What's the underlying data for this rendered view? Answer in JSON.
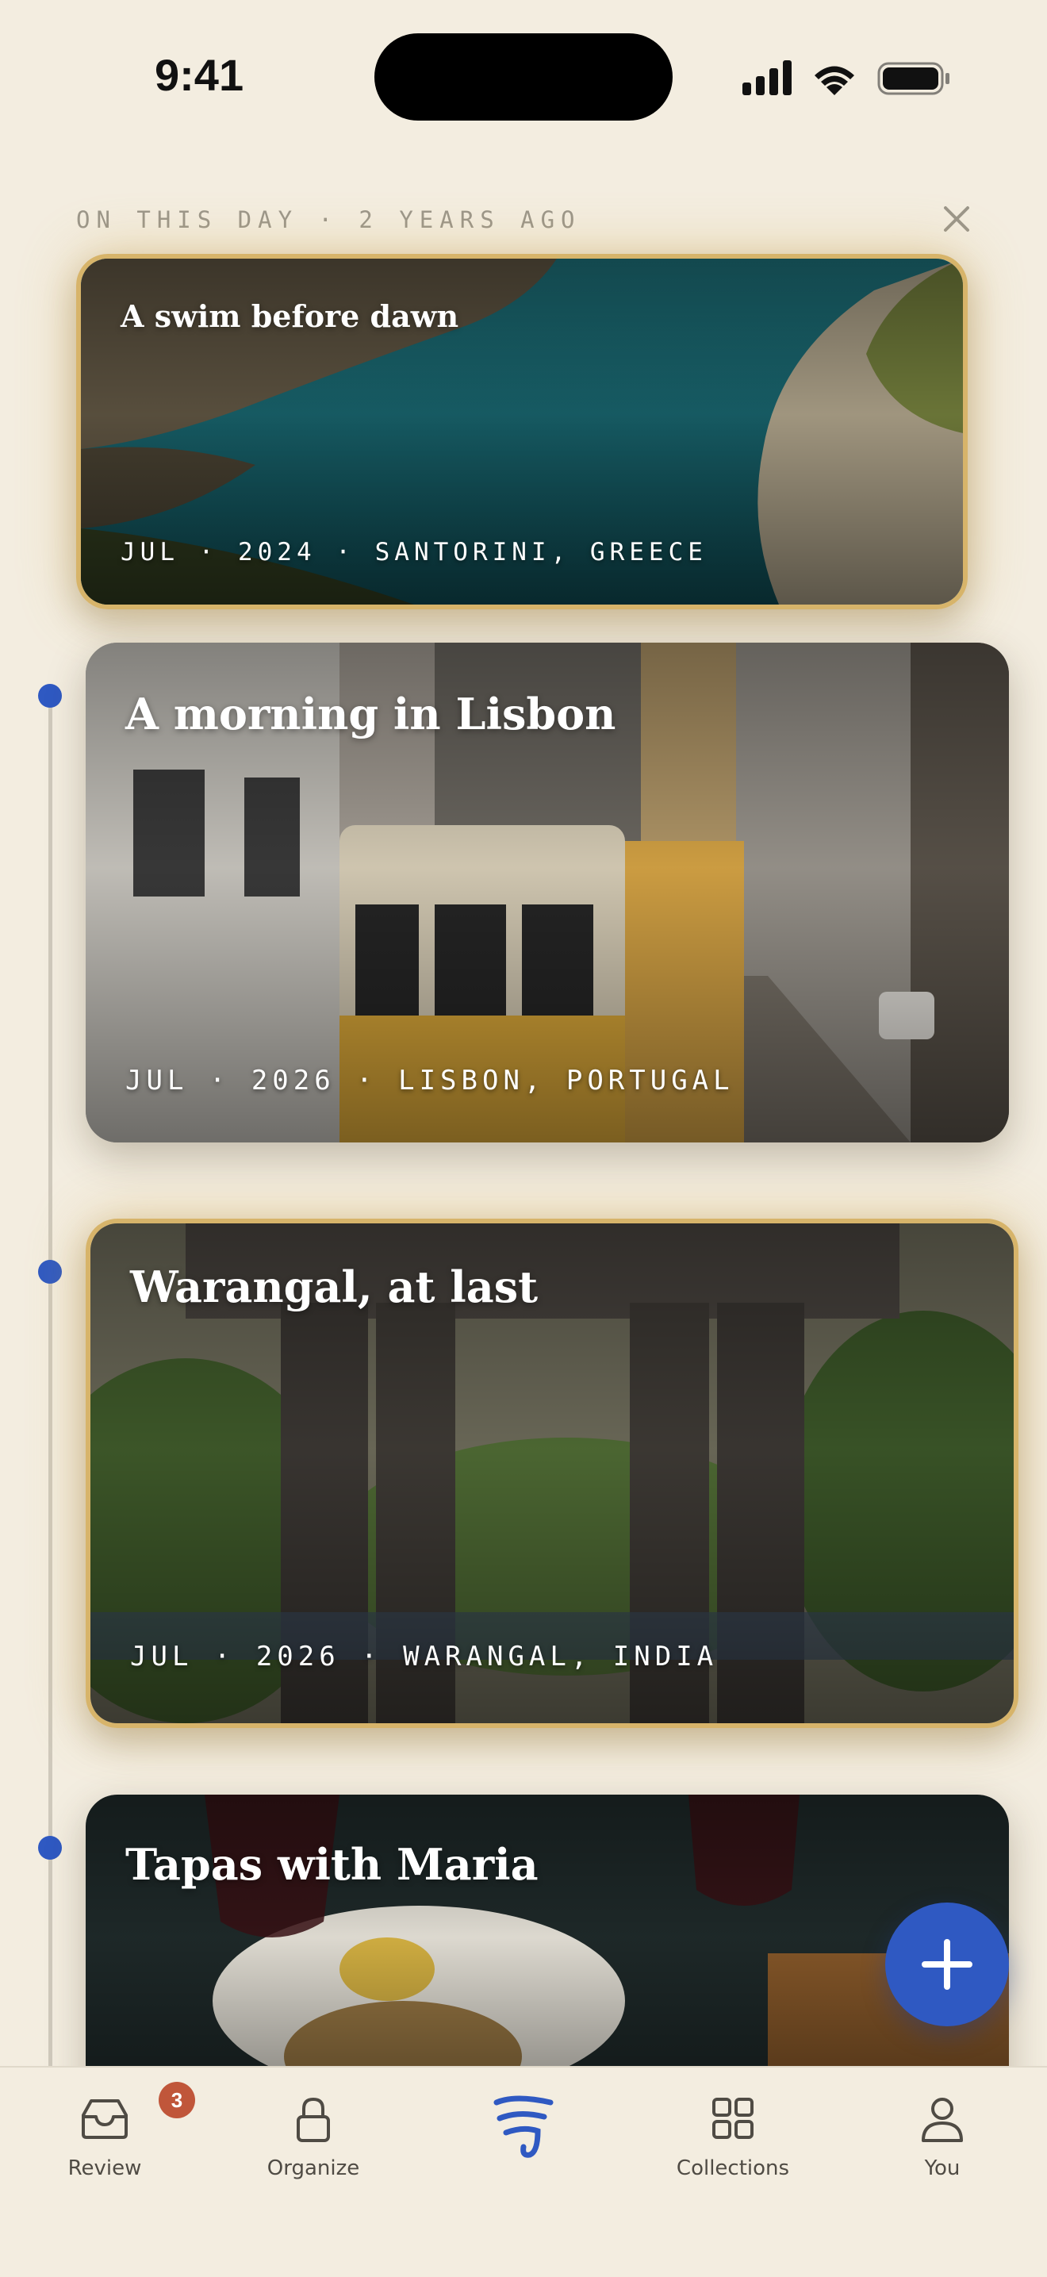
{
  "status_bar": {
    "time": "9:41"
  },
  "on_this_day": {
    "label": "ON THIS DAY · 2 YEARS AGO",
    "card": {
      "title": "A swim before dawn",
      "meta": "JUL · 2024 · SANTORINI, GREECE"
    }
  },
  "timeline": [
    {
      "title": "A morning in Lisbon",
      "meta": "JUL · 2026 · LISBON, PORTUGAL",
      "highlighted": false
    },
    {
      "title": "Warangal, at last",
      "meta": "JUL · 2026 · WARANGAL, INDIA",
      "highlighted": true
    },
    {
      "title": "Tapas with Maria",
      "meta": "",
      "highlighted": false
    }
  ],
  "tab_bar": {
    "items": [
      {
        "label": "Review",
        "icon": "inbox-icon",
        "badge": "3"
      },
      {
        "label": "Organize",
        "icon": "lock-icon"
      },
      {
        "label": "",
        "icon": "app-logo-icon",
        "active": true
      },
      {
        "label": "Collections",
        "icon": "grid-icon"
      },
      {
        "label": "You",
        "icon": "person-icon"
      }
    ]
  },
  "colors": {
    "accent": "#2f59c2",
    "background": "#f3ede0",
    "highlight_border": "#d7b46a",
    "badge": "#c0563a"
  }
}
